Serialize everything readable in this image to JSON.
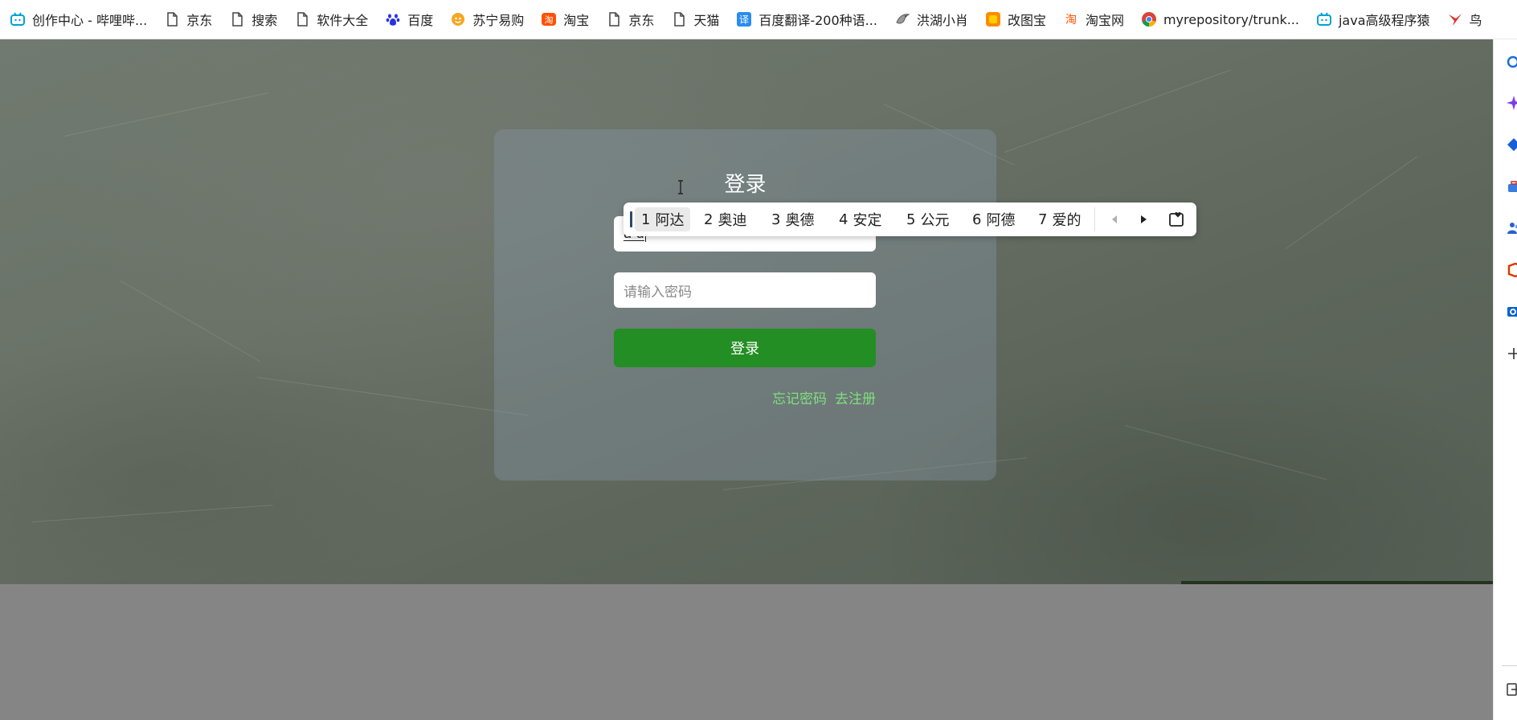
{
  "bookmarks": [
    {
      "label": "创作中心 - 哔哩哔...",
      "icon": "bilibili-icon",
      "color": "#00a1d6"
    },
    {
      "label": "京东",
      "icon": "page-icon",
      "color": "#444444"
    },
    {
      "label": "搜索",
      "icon": "page-icon",
      "color": "#444444"
    },
    {
      "label": "软件大全",
      "icon": "page-icon",
      "color": "#444444"
    },
    {
      "label": "百度",
      "icon": "baidu-paw-icon",
      "color": "#2932e1"
    },
    {
      "label": "苏宁易购",
      "icon": "suning-icon",
      "color": "#f5a623"
    },
    {
      "label": "淘宝",
      "icon": "taobao-icon",
      "color": "#ff5000"
    },
    {
      "label": "京东",
      "icon": "page-icon",
      "color": "#444444"
    },
    {
      "label": "天猫",
      "icon": "page-icon",
      "color": "#444444"
    },
    {
      "label": "百度翻译-200种语...",
      "icon": "baidu-translate-icon",
      "color": "#2a8cf0"
    },
    {
      "label": "洪湖小肖",
      "icon": "bird-icon",
      "color": "#666666"
    },
    {
      "label": "改图宝",
      "icon": "gaitubao-icon",
      "color": "#ff8a00"
    },
    {
      "label": "淘宝网",
      "icon": "taobao-icon",
      "color": "#ff5000"
    },
    {
      "label": "myrepository/trunk...",
      "icon": "chrome-icon",
      "color": "#db4437"
    },
    {
      "label": "java高级程序猿",
      "icon": "bilibili-icon",
      "color": "#00a1d6"
    },
    {
      "label": "鸟",
      "icon": "red-bird-icon",
      "color": "#e0312a"
    }
  ],
  "login": {
    "title": "登录",
    "username_value": "a'd",
    "password_placeholder": "请输入密码",
    "submit_label": "登录",
    "forgot_link": "忘记密码",
    "register_link": "去注册",
    "button_color": "#238e23",
    "link_color": "#7fe07f"
  },
  "ime": {
    "candidates": [
      {
        "num": "1",
        "text": "阿达"
      },
      {
        "num": "2",
        "text": "奥迪"
      },
      {
        "num": "3",
        "text": "奥德"
      },
      {
        "num": "4",
        "text": "安定"
      },
      {
        "num": "5",
        "text": "公元"
      },
      {
        "num": "6",
        "text": "阿德"
      },
      {
        "num": "7",
        "text": "爱的"
      }
    ],
    "selected_index": 0,
    "prev_icon": "triangle-left-icon",
    "next_icon": "triangle-right-icon",
    "favorite_icon": "heart-box-icon"
  },
  "sidebar": {
    "icons": [
      "search-icon",
      "copilot-sparkle-icon",
      "tag-icon",
      "briefcase-icon",
      "people-icon",
      "office-icon",
      "outlook-icon",
      "add-icon",
      "exit-icon"
    ]
  }
}
